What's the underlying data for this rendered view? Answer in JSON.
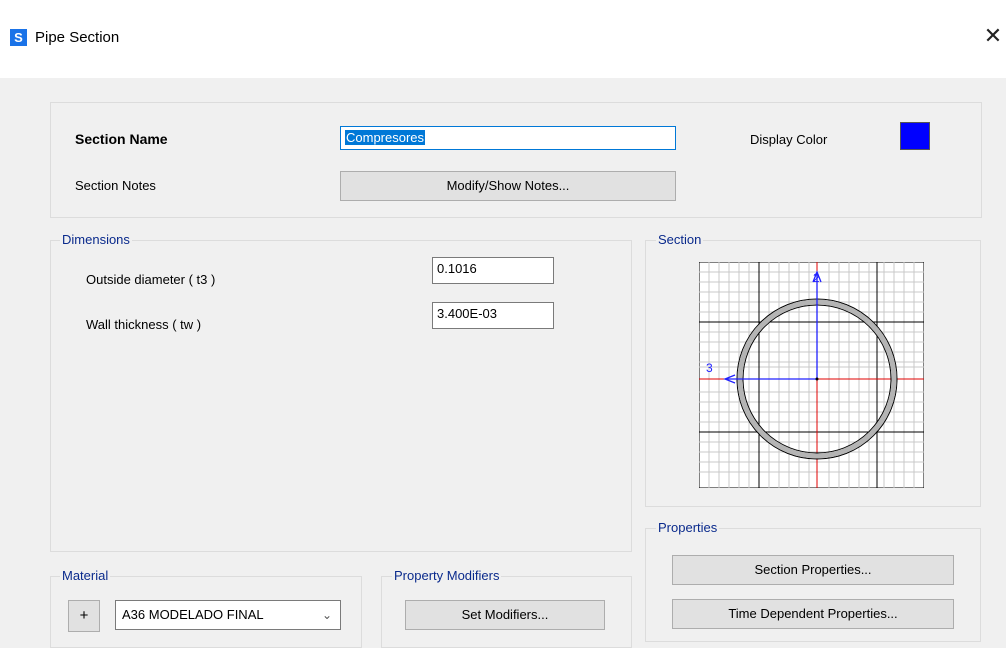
{
  "window": {
    "title": "Pipe Section",
    "app_icon_letter": "S",
    "close_glyph": "✕"
  },
  "section": {
    "name_label": "Section Name",
    "name_value": "Compresores",
    "notes_label": "Section Notes",
    "notes_button": "Modify/Show Notes...",
    "display_color_label": "Display Color",
    "display_color": "#0000ff"
  },
  "dimensions": {
    "legend": "Dimensions",
    "outside_diameter_label": "Outside diameter  ( t3 )",
    "outside_diameter_value": "0.1016",
    "wall_thickness_label": "Wall thickness  ( tw )",
    "wall_thickness_value": "3.400E-03"
  },
  "section_preview": {
    "legend": "Section",
    "axis_2": "2",
    "axis_3": "3"
  },
  "properties": {
    "legend": "Properties",
    "section_properties_button": "Section Properties...",
    "time_dependent_button": "Time Dependent Properties..."
  },
  "material": {
    "legend": "Material",
    "add_button": "+",
    "selected": "A36 MODELADO FINAL"
  },
  "property_modifiers": {
    "legend": "Property Modifiers",
    "set_button": "Set Modifiers..."
  }
}
